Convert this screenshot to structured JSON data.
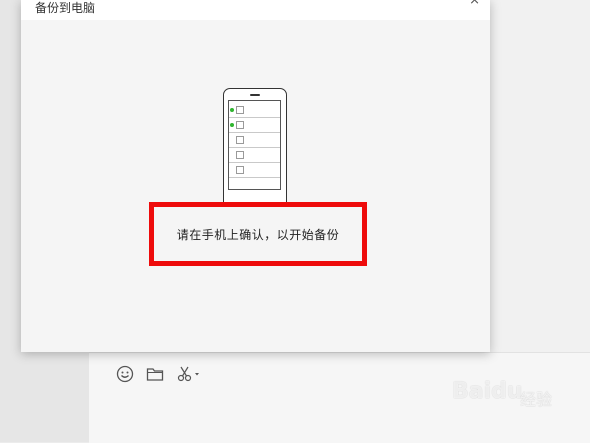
{
  "dialog": {
    "title": "备份到电脑",
    "close_symbol": "×",
    "confirm_message": "请在手机上确认，以开始备份",
    "phone_rows": [
      {
        "checked": true
      },
      {
        "checked": true
      },
      {
        "checked": false
      },
      {
        "checked": false
      },
      {
        "checked": false
      }
    ]
  },
  "toolbar": {
    "icons": [
      "emoji-icon",
      "folder-icon",
      "scissors-icon"
    ]
  },
  "watermark": {
    "brand": "Baidu",
    "suffix": "经验"
  },
  "colors": {
    "highlight": "#ee0b0b",
    "check_dot": "#2fb52f"
  }
}
